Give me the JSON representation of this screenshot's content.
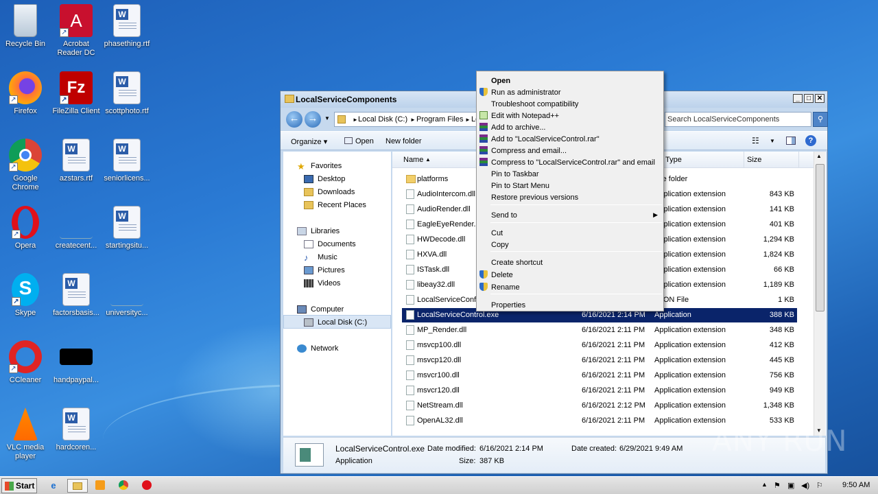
{
  "desktop": {
    "icons": [
      {
        "label": "Recycle Bin"
      },
      {
        "label": "Acrobat Reader DC"
      },
      {
        "label": "phasething.rtf"
      },
      {
        "label": "Firefox"
      },
      {
        "label": "FileZilla Client"
      },
      {
        "label": "scottphoto.rtf"
      },
      {
        "label": "Google Chrome"
      },
      {
        "label": "azstars.rtf"
      },
      {
        "label": "seniorlicens..."
      },
      {
        "label": "Opera"
      },
      {
        "label": "createcent..."
      },
      {
        "label": "startingsitu..."
      },
      {
        "label": "Skype"
      },
      {
        "label": "factorsbasis..."
      },
      {
        "label": "universityc..."
      },
      {
        "label": "CCleaner"
      },
      {
        "label": "handpaypal..."
      },
      {
        "label": "VLC media player"
      },
      {
        "label": "hardcoren..."
      }
    ]
  },
  "window": {
    "title": "LocalServiceComponents",
    "buttons": {
      "min": "_",
      "max": "□",
      "close": "✕"
    },
    "address": {
      "crumbs": [
        "Local Disk (C:)",
        "Program Files",
        "Lo"
      ],
      "search_placeholder": "Search LocalServiceComponents"
    },
    "toolbar": {
      "organize": "Organize",
      "open": "Open",
      "new_folder": "New folder"
    },
    "nav": {
      "favorites": "Favorites",
      "desktop": "Desktop",
      "downloads": "Downloads",
      "recent": "Recent Places",
      "libraries": "Libraries",
      "documents": "Documents",
      "music": "Music",
      "pictures": "Pictures",
      "videos": "Videos",
      "computer": "Computer",
      "local_disk": "Local Disk (C:)",
      "network": "Network"
    },
    "columns": {
      "name": "Name",
      "type": "Type",
      "size": "Size"
    },
    "files": [
      {
        "name": "platforms",
        "date": "",
        "type": "File folder",
        "size": ""
      },
      {
        "name": "AudioIntercom.dll",
        "date": "",
        "type": "Application extension",
        "size": "843 KB"
      },
      {
        "name": "AudioRender.dll",
        "date": "",
        "type": "Application extension",
        "size": "141 KB"
      },
      {
        "name": "EagleEyeRender.d",
        "date": "",
        "type": "Application extension",
        "size": "401 KB"
      },
      {
        "name": "HWDecode.dll",
        "date": "",
        "type": "Application extension",
        "size": "1,294 KB"
      },
      {
        "name": "HXVA.dll",
        "date": "",
        "type": "Application extension",
        "size": "1,824 KB"
      },
      {
        "name": "ISTask.dll",
        "date": "",
        "type": "Application extension",
        "size": "66 KB"
      },
      {
        "name": "libeay32.dll",
        "date": "",
        "type": "Application extension",
        "size": "1,189 KB"
      },
      {
        "name": "LocalServiceConfi",
        "date": "",
        "type": "JSON File",
        "size": "1 KB"
      },
      {
        "name": "LocalServiceControl.exe",
        "date": "6/16/2021 2:14 PM",
        "type": "Application",
        "size": "388 KB"
      },
      {
        "name": "MP_Render.dll",
        "date": "6/16/2021 2:11 PM",
        "type": "Application extension",
        "size": "348 KB"
      },
      {
        "name": "msvcp100.dll",
        "date": "6/16/2021 2:11 PM",
        "type": "Application extension",
        "size": "412 KB"
      },
      {
        "name": "msvcp120.dll",
        "date": "6/16/2021 2:11 PM",
        "type": "Application extension",
        "size": "445 KB"
      },
      {
        "name": "msvcr100.dll",
        "date": "6/16/2021 2:11 PM",
        "type": "Application extension",
        "size": "756 KB"
      },
      {
        "name": "msvcr120.dll",
        "date": "6/16/2021 2:11 PM",
        "type": "Application extension",
        "size": "949 KB"
      },
      {
        "name": "NetStream.dll",
        "date": "6/16/2021 2:12 PM",
        "type": "Application extension",
        "size": "1,348 KB"
      },
      {
        "name": "OpenAL32.dll",
        "date": "6/16/2021 2:11 PM",
        "type": "Application extension",
        "size": "533 KB"
      }
    ],
    "details": {
      "filename": "LocalServiceControl.exe",
      "kind": "Application",
      "modified_label": "Date modified:",
      "modified": "6/16/2021 2:14 PM",
      "created_label": "Date created:",
      "created": "6/29/2021 9:49 AM",
      "size_label": "Size:",
      "size": "387 KB"
    }
  },
  "context_menu": {
    "items": [
      {
        "label": "Open",
        "icon": ""
      },
      {
        "label": "Run as administrator",
        "icon": "shield-icon"
      },
      {
        "label": "Troubleshoot compatibility",
        "icon": ""
      },
      {
        "label": "Edit with Notepad++",
        "icon": "notepad-plus-plus-icon"
      },
      {
        "label": "Add to archive...",
        "icon": "winrar-icon"
      },
      {
        "label": "Add to \"LocalServiceControl.rar\"",
        "icon": "winrar-icon"
      },
      {
        "label": "Compress and email...",
        "icon": "winrar-icon"
      },
      {
        "label": "Compress to \"LocalServiceControl.rar\" and email",
        "icon": "winrar-icon"
      },
      {
        "label": "Pin to Taskbar",
        "icon": ""
      },
      {
        "label": "Pin to Start Menu",
        "icon": ""
      },
      {
        "label": "Restore previous versions",
        "icon": ""
      },
      {
        "label": "Send to",
        "icon": ""
      },
      {
        "label": "Cut",
        "icon": ""
      },
      {
        "label": "Copy",
        "icon": ""
      },
      {
        "label": "Create shortcut",
        "icon": ""
      },
      {
        "label": "Delete",
        "icon": "shield-icon"
      },
      {
        "label": "Rename",
        "icon": "shield-icon"
      },
      {
        "label": "Properties",
        "icon": ""
      }
    ]
  },
  "taskbar": {
    "start": "Start",
    "clock": "9:50 AM"
  },
  "watermark": "ANY RUN"
}
